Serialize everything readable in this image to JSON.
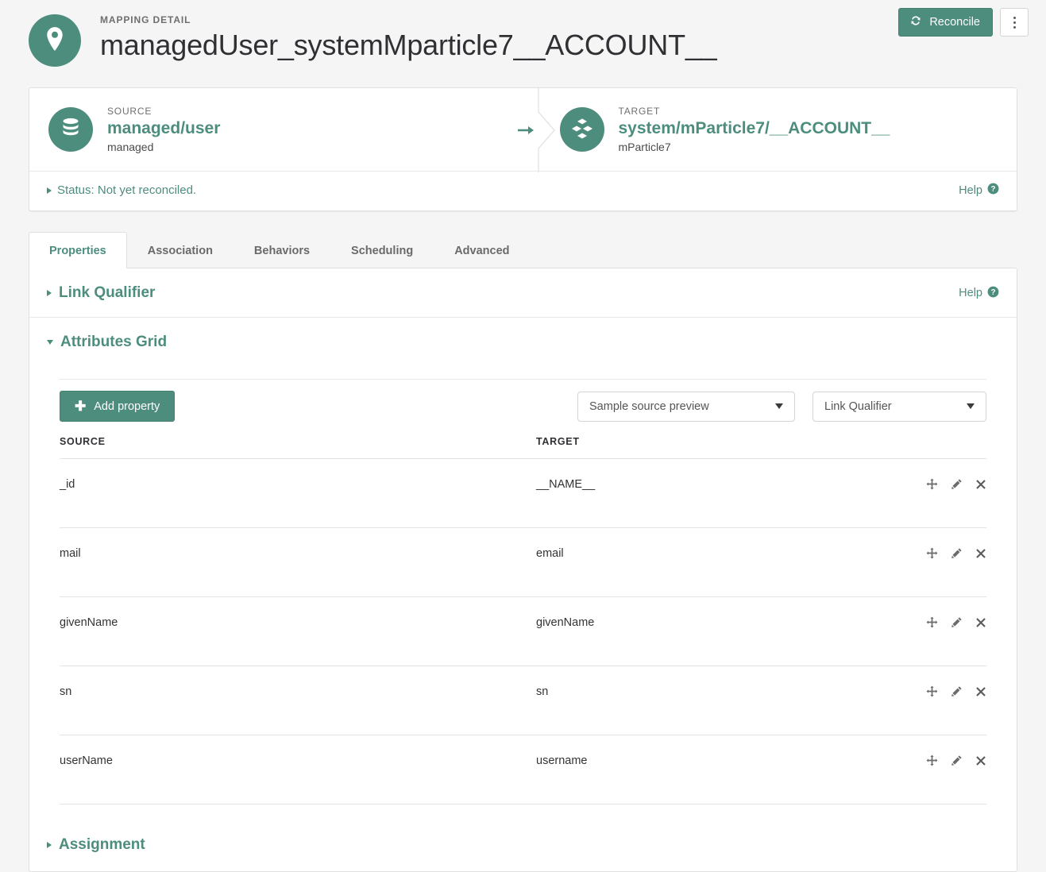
{
  "header": {
    "eyebrow": "MAPPING DETAIL",
    "title": "managedUser_systemMparticle7__ACCOUNT__",
    "avatar_icon": "location-pin-icon",
    "reconcile_label": "Reconcile",
    "reconcile_icon": "sync-refresh-icon",
    "kebab_icon": "vertical-dots-icon",
    "accent_color": "#4d8d7e"
  },
  "endpoints": {
    "source": {
      "label": "SOURCE",
      "name": "managed/user",
      "sub": "managed",
      "icon": "database-icon"
    },
    "arrow_icon": "arrow-right-icon",
    "target": {
      "label": "TARGET",
      "name": "system/mParticle7/__ACCOUNT__",
      "sub": "mParticle7",
      "icon": "cubes-icon"
    }
  },
  "status": {
    "text": "Status: Not yet reconciled.",
    "expanded": false,
    "disclosure_icon": "triangle-right-icon",
    "help_label": "Help",
    "help_icon": "question-circle-icon"
  },
  "tabs": [
    {
      "label": "Properties",
      "active": true
    },
    {
      "label": "Association",
      "active": false
    },
    {
      "label": "Behaviors",
      "active": false
    },
    {
      "label": "Scheduling",
      "active": false
    },
    {
      "label": "Advanced",
      "active": false
    }
  ],
  "sections": {
    "link_qualifier": {
      "title": "Link Qualifier",
      "expanded": false,
      "disclosure_icon": "triangle-right-icon",
      "help_label": "Help",
      "help_icon": "question-circle-icon"
    },
    "attributes_grid": {
      "title": "Attributes Grid",
      "expanded": true,
      "disclosure_icon": "triangle-down-icon"
    },
    "assignment": {
      "title": "Assignment",
      "expanded": false,
      "disclosure_icon": "triangle-right-icon"
    }
  },
  "grid_toolbar": {
    "add_property_label": "Add property",
    "add_property_icon": "plus-icon",
    "sample_preview_select": {
      "value": "Sample source preview",
      "caret_icon": "chevron-down-icon"
    },
    "link_qualifier_select": {
      "value": "Link Qualifier",
      "caret_icon": "chevron-down-icon"
    }
  },
  "grid": {
    "columns": [
      "SOURCE",
      "TARGET"
    ],
    "row_action_icons": [
      "move-icon",
      "edit-pencil-icon",
      "delete-x-icon"
    ],
    "rows": [
      {
        "source": "_id",
        "target": "__NAME__"
      },
      {
        "source": "mail",
        "target": "email"
      },
      {
        "source": "givenName",
        "target": "givenName"
      },
      {
        "source": "sn",
        "target": "sn"
      },
      {
        "source": "userName",
        "target": "username"
      }
    ]
  }
}
